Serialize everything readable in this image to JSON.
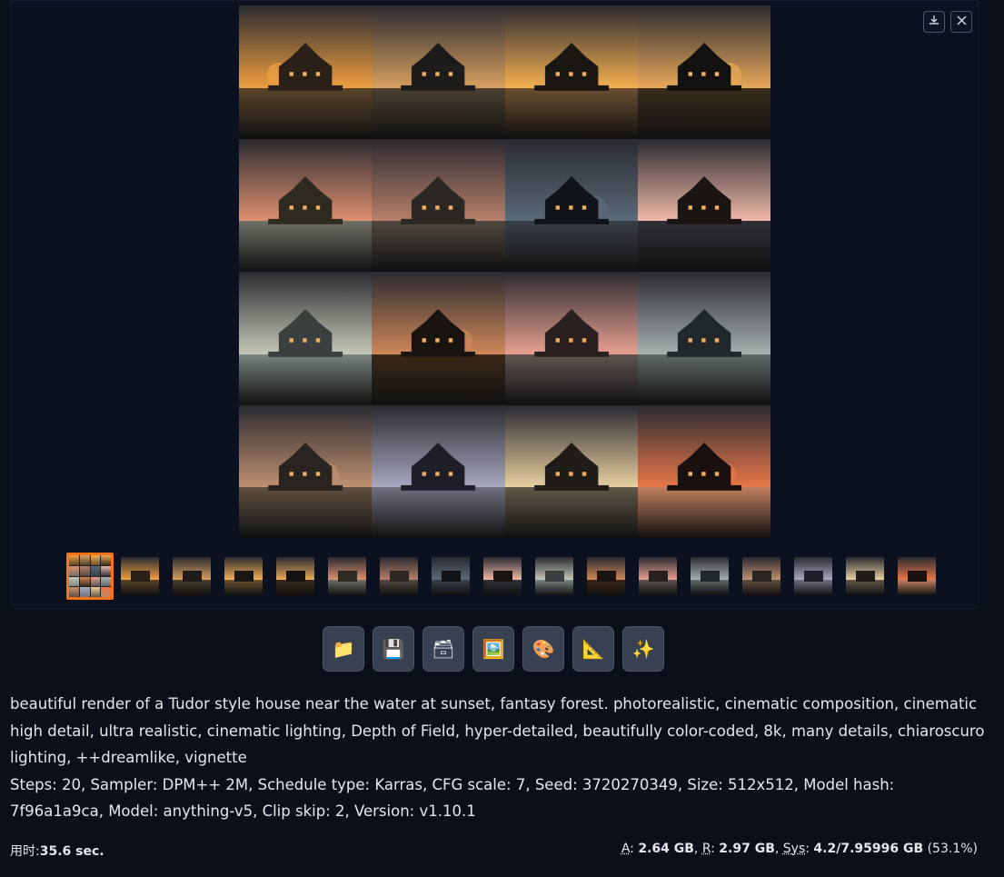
{
  "gallery": {
    "download_icon": "download-icon",
    "close_icon": "close-icon",
    "thumbnail_count": 17,
    "selected_thumbnail": 0
  },
  "toolbar": {
    "buttons": [
      {
        "name": "open-folder-button",
        "icon": "📁"
      },
      {
        "name": "save-button",
        "icon": "💾"
      },
      {
        "name": "zip-button",
        "icon": "🗃"
      },
      {
        "name": "send-to-img2img-button",
        "icon": "🖼️"
      },
      {
        "name": "send-to-inpaint-button",
        "icon": "🎨"
      },
      {
        "name": "send-to-extras-button",
        "icon": "📐"
      },
      {
        "name": "upscale-button",
        "icon": "✨"
      }
    ]
  },
  "info": {
    "prompt": "beautiful render of a Tudor style house near the water at sunset, fantasy forest. photorealistic, cinematic composition, cinematic high detail, ultra realistic, cinematic lighting, Depth of Field, hyper-detailed, beautifully color-coded, 8k, many details, chiaroscuro lighting, ++dreamlike, vignette",
    "params": "Steps: 20, Sampler: DPM++ 2M, Schedule type: Karras, CFG scale: 7, Seed: 3720270349, Size: 512x512, Model hash: 7f96a1a9ca, Model: anything-v5, Clip skip: 2, Version: v1.10.1"
  },
  "footer": {
    "time_label": "用时:",
    "time_value": "35.6 sec.",
    "a_label": "A",
    "a_value": "2.64 GB",
    "r_label": "R",
    "r_value": "2.97 GB",
    "sys_label": "Sys",
    "sys_value": "4.2/7.95996 GB",
    "sys_percent": "(53.1%)"
  }
}
